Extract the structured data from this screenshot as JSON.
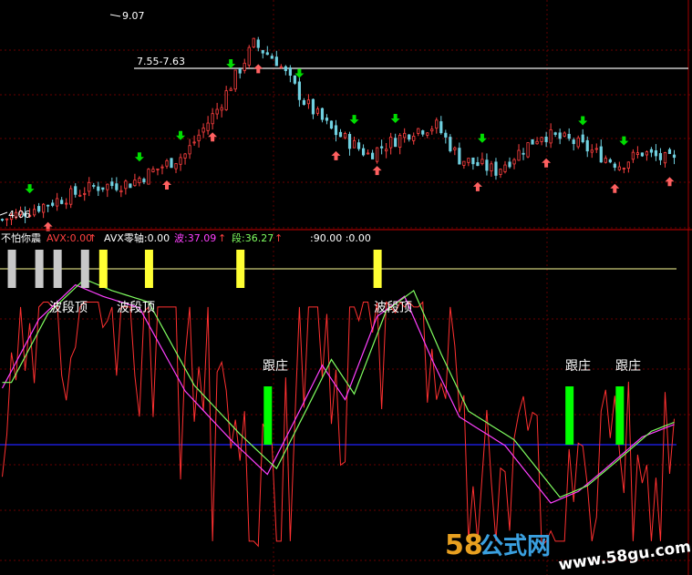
{
  "indicator_bar": {
    "name": "不怕你震",
    "avx_label": "AVX:0.00",
    "avx_zero_label": "AVX零轴:0.00",
    "wave_label": "波:37.09",
    "segment_label": "段:36.27",
    "extra_label": ":90.00 :0.00"
  },
  "colors": {
    "background": "#000000",
    "panel_border": "#cc0000",
    "grid": "#8b0000",
    "candle_up": "#ff4040",
    "candle_down": "#70d0e0",
    "arrow_sell": "#00dd00",
    "arrow_buy": "#ff6060",
    "wave_line": "#ff40ff",
    "segment_line": "#80ff60",
    "osc_line": "#ff3030",
    "ref_line_top": "#ffff99",
    "ref_line_zero": "#2020ff",
    "marker_yellow": "#ffff33",
    "marker_gray": "#c8c8c8",
    "marker_green": "#00ff00",
    "label_text": "#ffffff"
  },
  "price_panel": {
    "high_label": "9.07",
    "low_label": "4.06",
    "range_label": "7.55-7.63"
  },
  "signal_labels": {
    "wave_top": "波段顶",
    "follow_dealer": "跟庄"
  },
  "watermark": {
    "num": "58",
    "cn": "公式网",
    "url": "www.58gu.com"
  },
  "chart_data": [
    {
      "type": "candlestick",
      "ylim": [
        3.9,
        9.3
      ],
      "price_high": 9.07,
      "price_low": 4.06,
      "resistance_band": [
        7.55,
        7.63
      ],
      "n": 148,
      "close_path_keypoints": [
        [
          0,
          4.1
        ],
        [
          10,
          4.5
        ],
        [
          20,
          4.9
        ],
        [
          28,
          5.0
        ],
        [
          40,
          5.7
        ],
        [
          47,
          6.8
        ],
        [
          55,
          8.4
        ],
        [
          60,
          8.0
        ],
        [
          66,
          7.0
        ],
        [
          72,
          6.3
        ],
        [
          80,
          5.7
        ],
        [
          90,
          6.3
        ],
        [
          95,
          6.4
        ],
        [
          100,
          5.6
        ],
        [
          108,
          5.3
        ],
        [
          118,
          6.2
        ],
        [
          125,
          6.0
        ],
        [
          135,
          5.45
        ],
        [
          140,
          5.75
        ],
        [
          144,
          5.6
        ],
        [
          148,
          5.5
        ]
      ],
      "sell_arrows_at": [
        6,
        30,
        39,
        50,
        65,
        77,
        86,
        105,
        127,
        136
      ],
      "buy_arrows_at": [
        10,
        36,
        46,
        56,
        73,
        82,
        104,
        119,
        134,
        146
      ]
    },
    {
      "type": "line",
      "series": [
        {
          "name": "波",
          "last": 37.09
        },
        {
          "name": "段",
          "last": 36.27
        },
        {
          "name": "AVX",
          "last": 0.0
        }
      ],
      "wave_keypoints": [
        [
          0,
          60
        ],
        [
          8,
          84
        ],
        [
          16,
          96
        ],
        [
          22,
          92
        ],
        [
          30,
          88
        ],
        [
          40,
          59
        ],
        [
          50,
          42
        ],
        [
          58,
          30
        ],
        [
          65,
          52
        ],
        [
          70,
          68
        ],
        [
          75,
          56
        ],
        [
          82,
          85
        ],
        [
          88,
          92
        ],
        [
          94,
          70
        ],
        [
          100,
          50
        ],
        [
          110,
          40
        ],
        [
          120,
          20
        ],
        [
          126,
          24
        ],
        [
          132,
          32
        ],
        [
          140,
          43
        ],
        [
          148,
          48
        ]
      ],
      "osc_range": [
        0,
        100
      ],
      "top_reference": 90.0,
      "zero_reference": 0.0,
      "wave_top_signals_at": [
        10,
        25,
        82
      ],
      "follow_signals_at": [
        58,
        124,
        135
      ]
    }
  ]
}
